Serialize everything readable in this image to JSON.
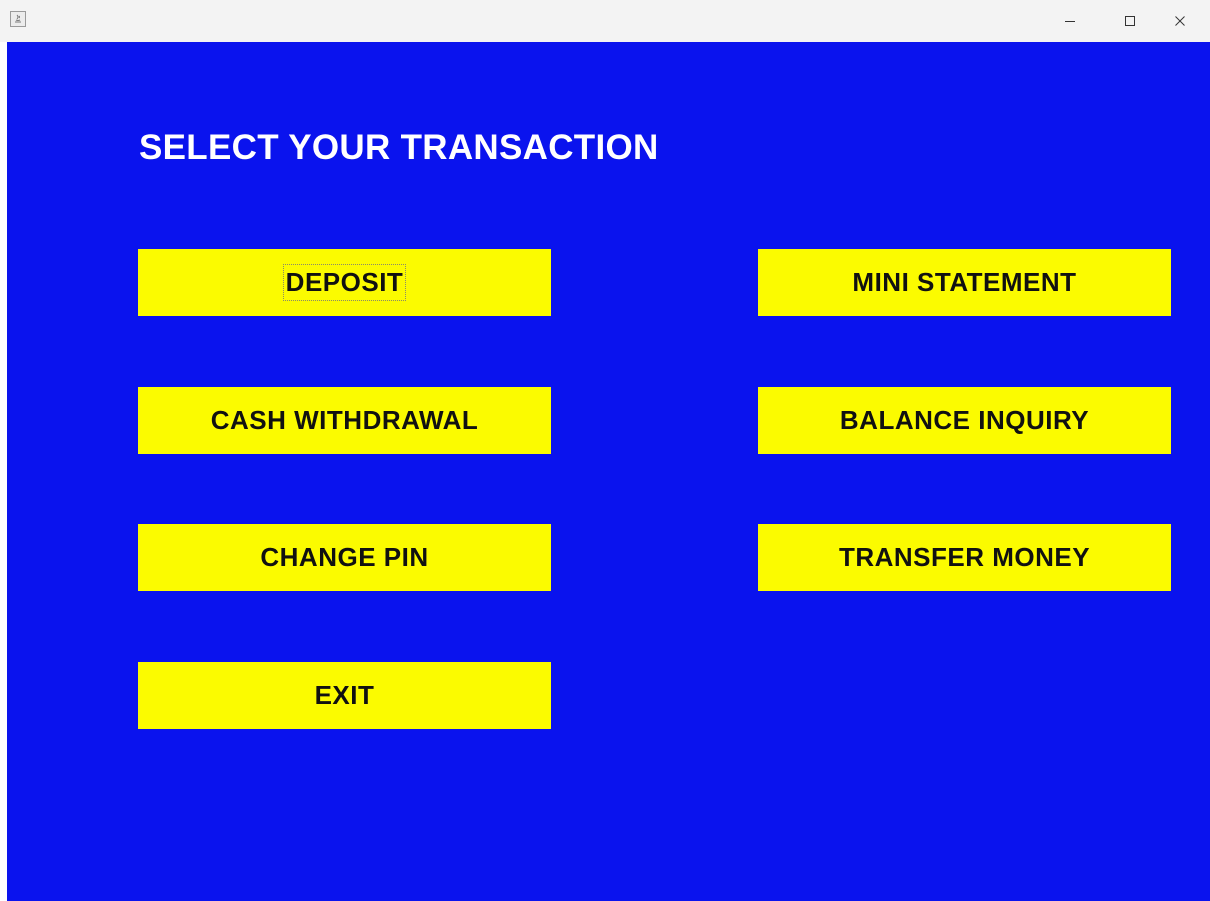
{
  "window": {
    "icons": {
      "app": "java-app-icon",
      "minimize": "minimize-icon",
      "maximize": "maximize-icon",
      "close": "close-icon"
    }
  },
  "colors": {
    "background": "#0a13ee",
    "button": "#fbfb00",
    "heading_text": "#ffffff",
    "button_text": "#111111"
  },
  "heading": "SELECT YOUR TRANSACTION",
  "buttons": {
    "deposit": "DEPOSIT",
    "mini_statement": "MINI STATEMENT",
    "cash_withdrawal": "CASH WITHDRAWAL",
    "balance_inquiry": "BALANCE INQUIRY",
    "change_pin": "CHANGE PIN",
    "transfer_money": "TRANSFER MONEY",
    "exit": "EXIT"
  }
}
